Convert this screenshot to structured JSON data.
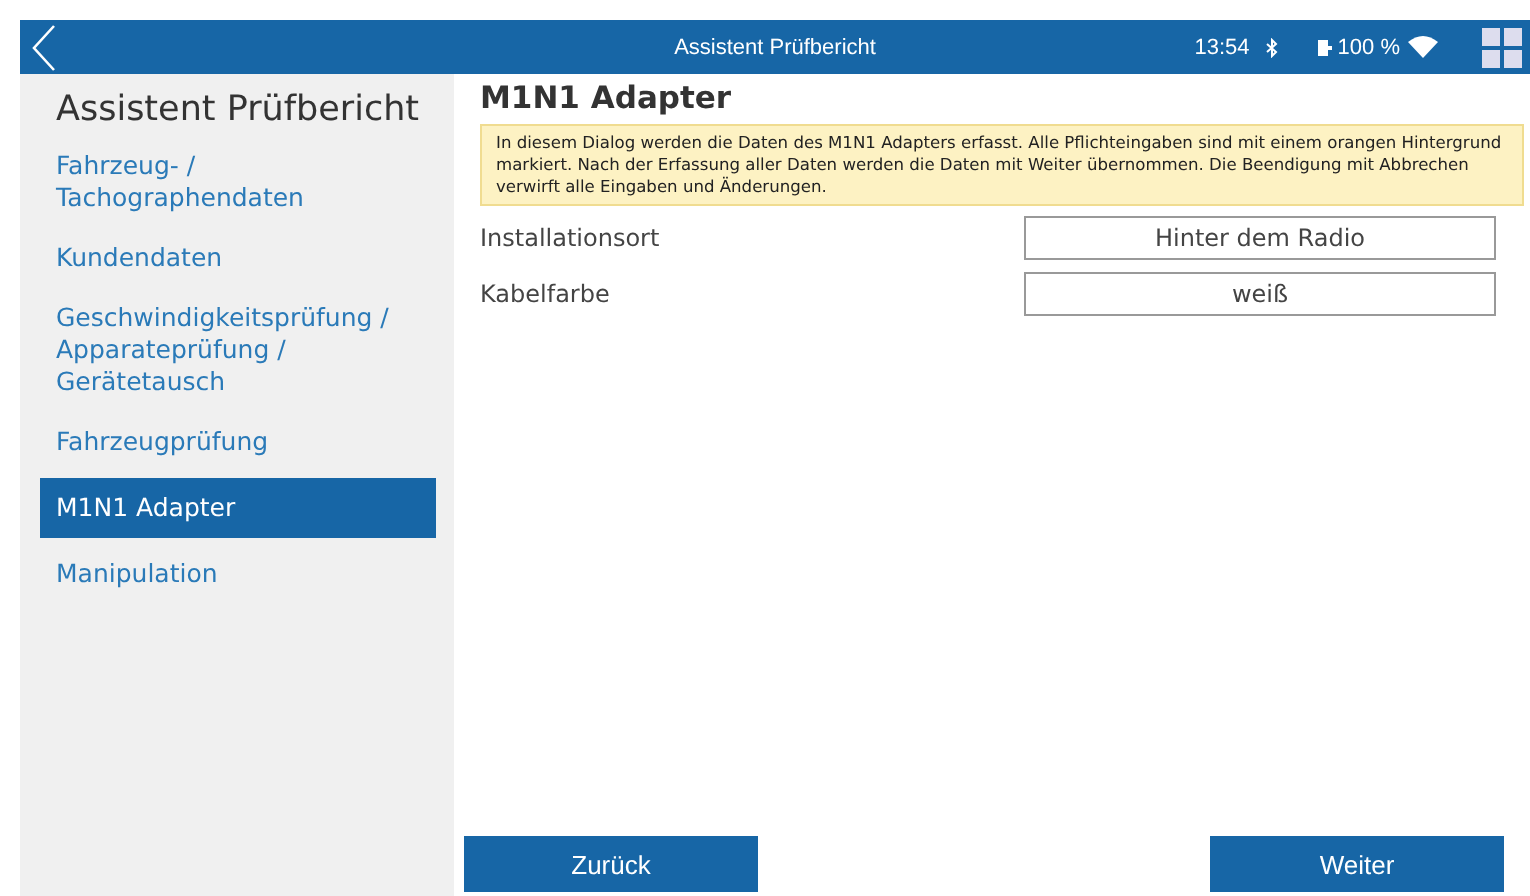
{
  "topbar": {
    "title": "Assistent Prüfbericht",
    "time": "13:54",
    "battery": "100 %"
  },
  "sidebar": {
    "title": "Assistent Prüfbericht",
    "items": [
      {
        "label": "Fahrzeug- / Tachographendaten",
        "selected": false
      },
      {
        "label": "Kundendaten",
        "selected": false
      },
      {
        "label": "Geschwindigkeitsprüfung / Apparateprüfung / Gerätetausch",
        "selected": false
      },
      {
        "label": "Fahrzeugprüfung",
        "selected": false
      },
      {
        "label": "M1N1 Adapter",
        "selected": true
      },
      {
        "label": "Manipulation",
        "selected": false
      }
    ]
  },
  "main": {
    "title": "M1N1 Adapter",
    "info": "In diesem Dialog werden die Daten des M1N1 Adapters erfasst. Alle Pflichteingaben sind mit einem orangen Hintergrund markiert. Nach der Erfassung aller Daten werden die Daten mit Weiter übernommen. Die Beendigung mit Abbrechen verwirft alle Eingaben und Änderungen.",
    "fields": [
      {
        "label": "Installationsort",
        "value": "Hinter dem Radio"
      },
      {
        "label": "Kabelfarbe",
        "value": "weiß"
      }
    ],
    "buttons": [
      "Zurück",
      "Weiter"
    ]
  }
}
